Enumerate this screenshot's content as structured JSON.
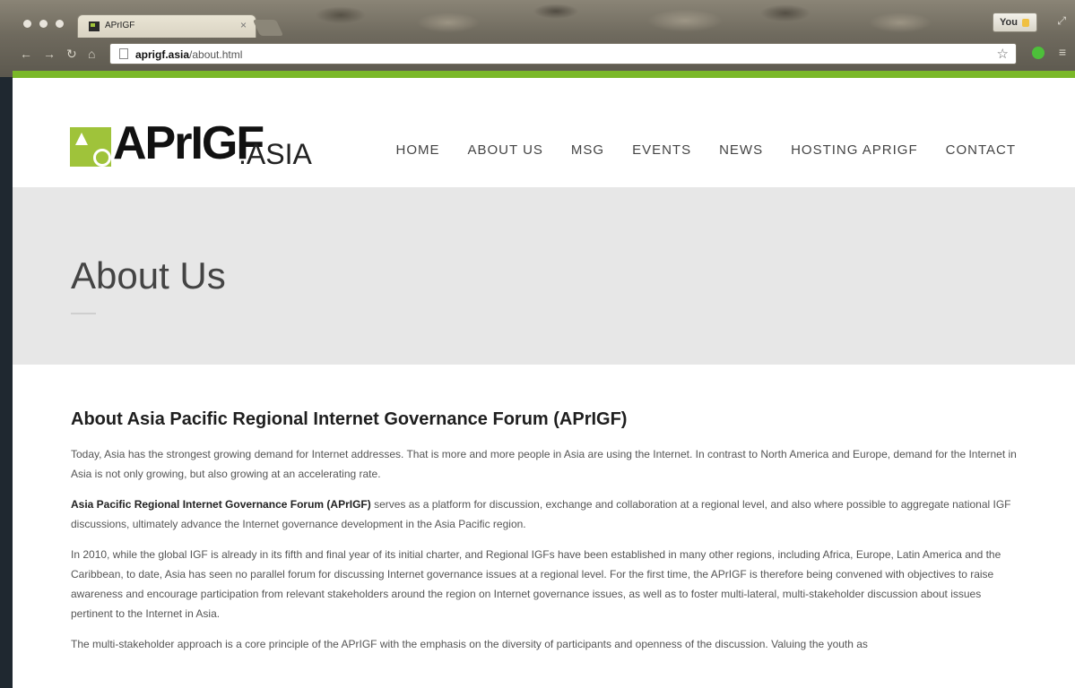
{
  "browser": {
    "tab_title": "APrIGF",
    "tab_close": "×",
    "profile_label": "You",
    "url_domain": "aprigf.asia",
    "url_path": "/about.html"
  },
  "site": {
    "logo_text": "APrIGF",
    "logo_suffix": ".ASIA",
    "nav": {
      "home": "HOME",
      "about": "ABOUT US",
      "msg": "MSG",
      "events": "EVENTS",
      "news": "NEWS",
      "hosting": "HOSTING APRIGF",
      "contact": "CONTACT"
    },
    "accent_color": "#9fc33a"
  },
  "page": {
    "title": "About Us",
    "section_heading": "About Asia Pacific Regional Internet Governance Forum (APrIGF)",
    "p1": "Today, Asia has the strongest growing demand for Internet addresses. That is more and more people in Asia are using the Internet. In contrast to North America and Europe, demand for the Internet in Asia is not only growing, but also growing at an accelerating rate.",
    "p2_bold": "Asia Pacific Regional Internet Governance Forum (APrIGF)",
    "p2_rest": " serves as a platform for discussion, exchange and collaboration at a regional level, and also where possible to aggregate national IGF discussions, ultimately advance the Internet governance development in the Asia Pacific region.",
    "p3": "In 2010, while the global IGF is already in its fifth and final year of its initial charter, and Regional IGFs have been established in many other regions, including Africa, Europe, Latin America and the Caribbean, to date, Asia has seen no parallel forum for discussing Internet governance issues at a regional level. For the first time, the APrIGF is therefore being convened with objectives to raise awareness and encourage participation from relevant stakeholders around the region on Internet governance issues, as well as to foster multi-lateral, multi-stakeholder discussion about issues pertinent to the Internet in Asia.",
    "p4": "The multi-stakeholder approach is a core principle of the APrIGF with the emphasis on the diversity of participants and openness of the discussion. Valuing the youth as"
  }
}
